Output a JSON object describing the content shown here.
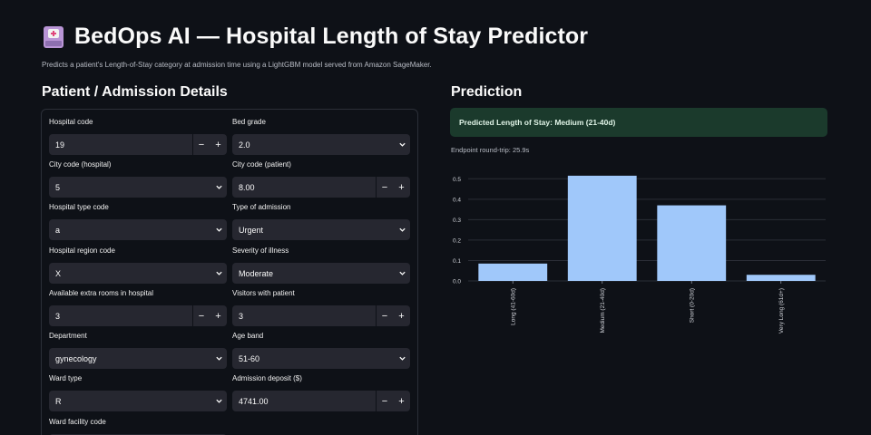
{
  "app": {
    "title": "BedOps AI — Hospital Length of Stay Predictor",
    "subtitle": "Predicts a patient's Length-of-Stay category at admission time using a LightGBM model served from Amazon SageMaker.",
    "logo_icon": "hospital-bed-icon"
  },
  "form": {
    "title": "Patient / Admission Details",
    "fields": {
      "hospital_code": {
        "label": "Hospital code",
        "value": "19"
      },
      "bed_grade": {
        "label": "Bed grade",
        "value": "2.0"
      },
      "city_code_hospital": {
        "label": "City code (hospital)",
        "value": "5"
      },
      "city_code_patient": {
        "label": "City code (patient)",
        "value": "8.00"
      },
      "hospital_type_code": {
        "label": "Hospital type code",
        "value": "a"
      },
      "type_of_admission": {
        "label": "Type of admission",
        "value": "Urgent"
      },
      "hospital_region_code": {
        "label": "Hospital region code",
        "value": "X"
      },
      "severity_of_illness": {
        "label": "Severity of illness",
        "value": "Moderate"
      },
      "extra_rooms": {
        "label": "Available extra rooms in hospital",
        "value": "3"
      },
      "visitors": {
        "label": "Visitors with patient",
        "value": "3"
      },
      "department": {
        "label": "Department",
        "value": "gynecology"
      },
      "age_band": {
        "label": "Age band",
        "value": "51-60"
      },
      "ward_type": {
        "label": "Ward type",
        "value": "R"
      },
      "admission_deposit": {
        "label": "Admission deposit ($)",
        "value": "4741.00"
      },
      "ward_facility_code": {
        "label": "Ward facility code",
        "value": ""
      }
    },
    "stepper_minus": "−",
    "stepper_plus": "+"
  },
  "prediction": {
    "title": "Prediction",
    "result_text": "Predicted Length of Stay: Medium (21-40d)",
    "latency_text": "Endpoint round-trip: 25.9s",
    "result_bg_color": "#1b3a2c"
  },
  "chart_data": {
    "type": "bar",
    "categories": [
      "Long (41-60d)",
      "Medium (21-40d)",
      "Short (0-20d)",
      "Very Long (61d+)"
    ],
    "values": [
      0.085,
      0.515,
      0.37,
      0.03
    ],
    "yticks": [
      "0.0",
      "0.1",
      "0.2",
      "0.3",
      "0.4",
      "0.5"
    ],
    "ylim": [
      0,
      0.55
    ],
    "bar_color": "#a0c8fa",
    "grid": true
  }
}
